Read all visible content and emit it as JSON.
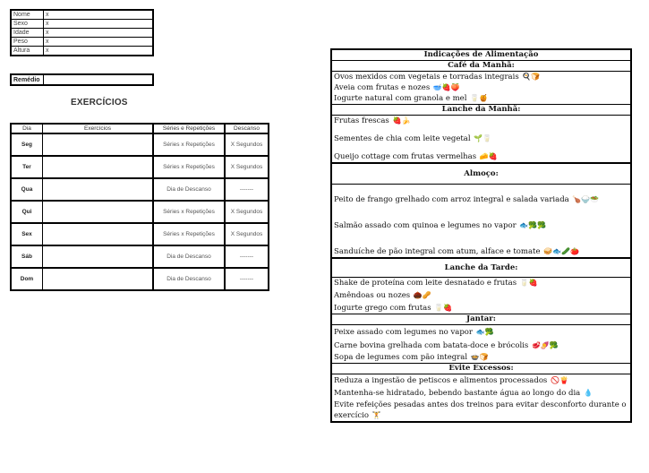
{
  "personal": {
    "rows": [
      {
        "label": "Nome",
        "value": "x"
      },
      {
        "label": "Sexo",
        "value": "x"
      },
      {
        "label": "Idade",
        "value": "x"
      },
      {
        "label": "Peso",
        "value": "x"
      },
      {
        "label": "Altura",
        "value": "x"
      }
    ],
    "remedio_label": "Remédio",
    "remedio_value": ""
  },
  "exercicios": {
    "title": "EXERCÍCIOS",
    "headers": {
      "dia": "Dia",
      "exercicios": "Exercícios",
      "series": "Séries e Repetições",
      "descanso": "Descanso"
    },
    "rows": [
      {
        "dia": "Seg",
        "exercicio": "",
        "series": "Séries x Repetições",
        "descanso": "X Segundos"
      },
      {
        "dia": "Ter",
        "exercicio": "",
        "series": "Séries x Repetições",
        "descanso": "X Segundos"
      },
      {
        "dia": "Qua",
        "exercicio": "",
        "series": "Dia de Descanso",
        "descanso": "-------"
      },
      {
        "dia": "Qui",
        "exercicio": "",
        "series": "Séries x Repetições",
        "descanso": "X Segundos"
      },
      {
        "dia": "Sex",
        "exercicio": "",
        "series": "Séries x Repetições",
        "descanso": "X Segundos"
      },
      {
        "dia": "Sáb",
        "exercicio": "",
        "series": "Dia de Descanso",
        "descanso": "-------"
      },
      {
        "dia": "Dom",
        "exercicio": "",
        "series": "Dia de Descanso",
        "descanso": "-------"
      }
    ]
  },
  "alimentacao": {
    "title": "Indicações de Alimentação",
    "cafe": {
      "title": "Café da Manhã:",
      "items": [
        {
          "text": "Ovos mexidos com vegetais e torradas integrais",
          "icons": "🍳🍞"
        },
        {
          "text": "Aveia com frutas e nozes",
          "icons": "🥣🍓🍑"
        },
        {
          "text": "Iogurte natural com granola e mel",
          "icons": "🥛🍯"
        }
      ]
    },
    "lanche_manha": {
      "title": "Lanche da Manhã:",
      "items": [
        {
          "text": "Frutas frescas",
          "icons": "🍓🍌"
        },
        {
          "text": "Sementes de chia com leite vegetal",
          "icons": "🌱🥛"
        },
        {
          "text": "Queijo cottage com frutas vermelhas",
          "icons": "🧀🍓"
        }
      ]
    },
    "almoco": {
      "title": "Almoço:",
      "items": [
        {
          "text": "Peito de frango grelhado com arroz integral e salada variada",
          "icons": "🍗🍚🥗"
        },
        {
          "text": "Salmão assado com quinoa e legumes no vapor",
          "icons": "🐟🥦🥦"
        },
        {
          "text": "Sanduíche de pão integral com atum, alface e tomate",
          "icons": "🥪🐟🥒🍅"
        }
      ]
    },
    "lanche_tarde": {
      "title": "Lanche da Tarde:",
      "items": [
        {
          "text": "Shake de proteína com leite desnatado e frutas",
          "icons": "🥛🍓"
        },
        {
          "text": "Amêndoas ou nozes",
          "icons": "🌰🥜"
        },
        {
          "text": "Iogurte grego com frutas",
          "icons": "🥛🍓"
        }
      ]
    },
    "jantar": {
      "title": "Jantar:",
      "items": [
        {
          "text": "Peixe assado com legumes no vapor",
          "icons": "🐟🥦"
        },
        {
          "text": "Carne bovina grelhada com batata-doce e brócolis",
          "icons": "🥩🍠🥦"
        },
        {
          "text": "Sopa de legumes com pão integral",
          "icons": "🍲🍞"
        }
      ]
    },
    "evite": {
      "title": "Evite Excessos:",
      "items": [
        {
          "text": "Reduza a ingestão de petiscos e alimentos processados",
          "icons": "🚫🍟"
        },
        {
          "text": "Mantenha-se hidratado, bebendo bastante água ao longo do dia",
          "icons": "💧"
        },
        {
          "text": "Evite refeições pesadas antes dos treinos para evitar desconforto durante o exercício",
          "icons": "🏋"
        }
      ]
    }
  }
}
